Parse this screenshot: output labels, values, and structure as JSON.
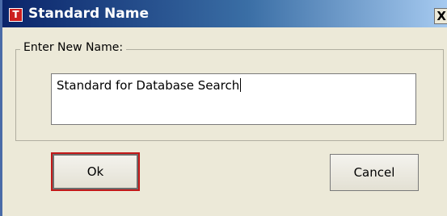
{
  "window": {
    "title": "Standard Name",
    "app_icon_letter": "T",
    "close_symbol": "X"
  },
  "group": {
    "legend": "Enter New Name:"
  },
  "name_input": {
    "value": "Standard for Database Search"
  },
  "buttons": {
    "ok_label": "Ok",
    "cancel_label": "Cancel"
  },
  "colors": {
    "titlebar_start": "#0a246a",
    "titlebar_end": "#a6caf0",
    "dialog_background": "#ece9d8",
    "default_button_border": "#c21818",
    "app_icon": "#cc1f1f"
  }
}
